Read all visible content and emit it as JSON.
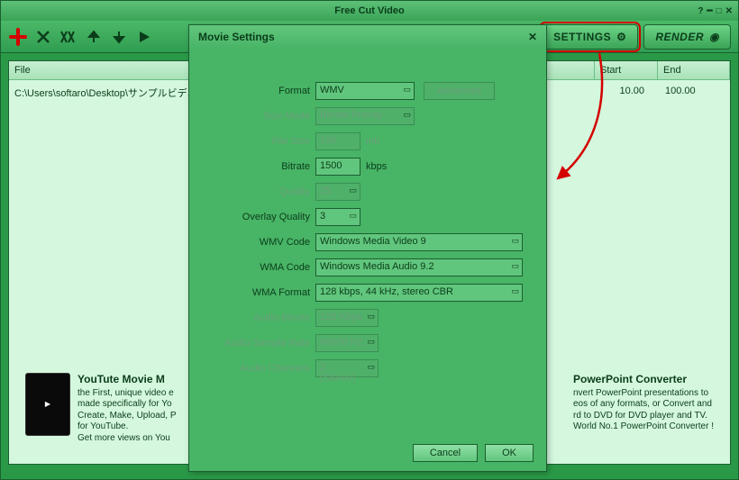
{
  "window": {
    "title": "Free Cut Video"
  },
  "toolbar": {
    "settings_label": "SETTINGS",
    "render_label": "RENDER"
  },
  "grid": {
    "headers": {
      "file": "File",
      "start": "Start",
      "end": "End"
    },
    "row": {
      "file": "C:\\Users\\softaro\\Desktop\\サンプルビデオ",
      "start": "10.00",
      "end": "100.00"
    }
  },
  "dialog": {
    "title": "Movie Settings",
    "advanced": "Advanced",
    "labels": {
      "format": "Format",
      "size_mode": "Size Mode",
      "file_size": "File Size",
      "bitrate": "Bitrate",
      "quality": "Quality",
      "overlay_quality": "Overlay Quality",
      "wmv_code": "WMV Code",
      "wma_code": "WMA Code",
      "wma_format": "WMA Format",
      "audio_bitrate": "Audio Bitrate",
      "audio_sample_rate": "Audio Sample Rate",
      "audio_channels": "Audio Channels"
    },
    "values": {
      "format": "WMV",
      "size_mode": "Bitrate Priority",
      "file_size": "100",
      "file_size_unit": "mb",
      "bitrate": "1500",
      "bitrate_unit": "kbps",
      "quality": "25",
      "overlay_quality": "3",
      "wmv_code": "Windows Media Video 9",
      "wma_code": "Windows Media Audio 9.2",
      "wma_format": "128 kbps, 44 kHz, stereo CBR",
      "audio_bitrate": "128 Kbps",
      "audio_sample_rate": "48000 Hz",
      "audio_channels": "2 (Stereo)"
    },
    "buttons": {
      "cancel": "Cancel",
      "ok": "OK"
    }
  },
  "promos": {
    "left": {
      "title": "YouTute Movie M",
      "line1": "the First, unique video e",
      "line2": "made specifically for Yo",
      "line3": "Create, Make, Upload, P",
      "line4": "for YouTube.",
      "line5": "Get more views on You"
    },
    "right": {
      "title": "PowerPoint Converter",
      "line1": "nvert PowerPoint presentations to",
      "line2": "eos of any formats, or Convert and",
      "line3": "rd to DVD for DVD player and TV.",
      "line4": "World No.1 PowerPoint Converter !"
    }
  }
}
